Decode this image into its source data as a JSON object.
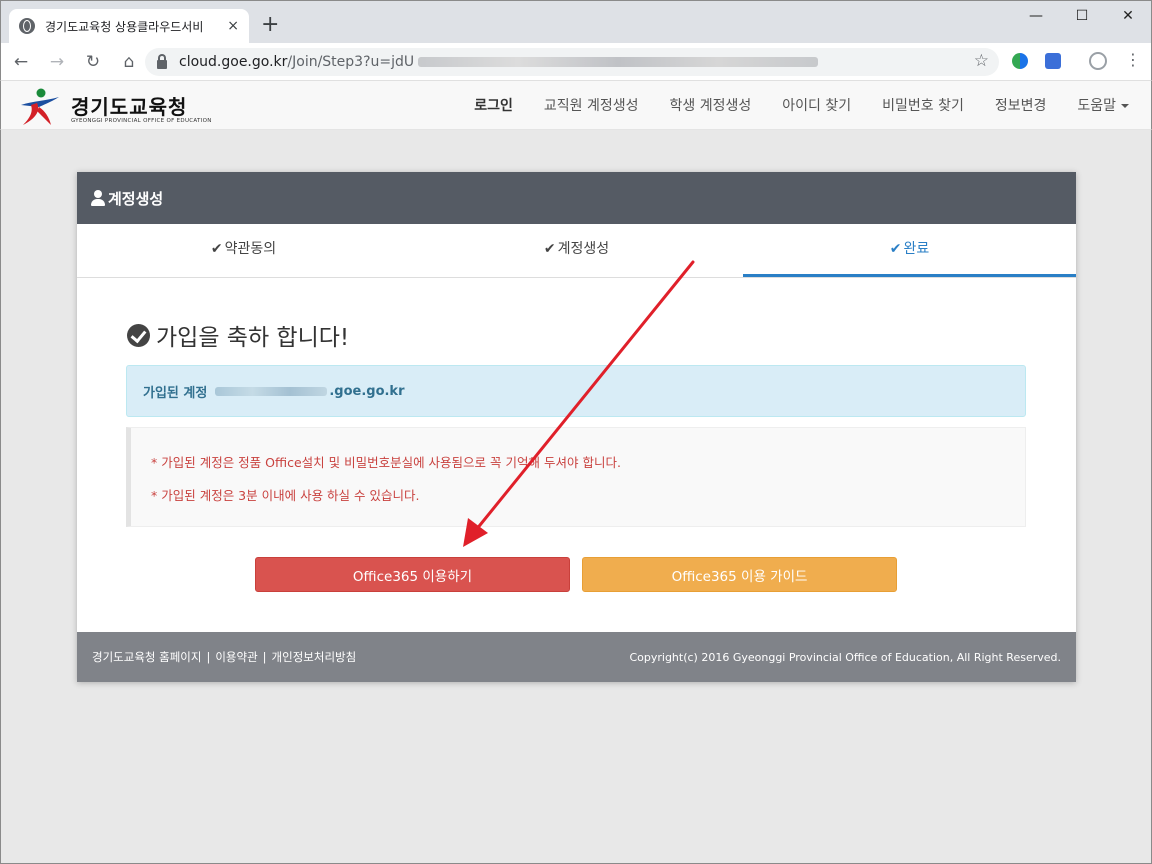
{
  "browser": {
    "tab_title": "경기도교육청 상용클라우드서비",
    "tab_close": "×",
    "new_tab": "+",
    "url_host": "cloud.goe.go.kr",
    "url_path": "/Join/Step3?u=jdU",
    "window_min": "—",
    "window_max": "☐",
    "window_close": "✕"
  },
  "site": {
    "logo_text": "경기도교육청",
    "logo_sub": "GYEONGGI PROVINCIAL OFFICE OF EDUCATION",
    "menu": [
      "로그인",
      "교직원 계정생성",
      "학생 계정생성",
      "아이디 찾기",
      "비밀번호 찾기",
      "정보변경",
      "도움말"
    ]
  },
  "panel": {
    "title": "계정생성",
    "steps": [
      "약관동의",
      "계정생성",
      "완료"
    ],
    "active_step": 2,
    "congrats": "가입을 축하 합니다!",
    "info_label": "가입된 계정",
    "info_domain": ".goe.go.kr",
    "notices": [
      "* 가입된 계정은 정품 Office설치 및 비밀번호분실에 사용됨으로 꼭 기억해 두셔야 합니다.",
      "* 가입된 계정은 3분 이내에 사용 하실 수 있습니다."
    ],
    "btn_use": "Office365 이용하기",
    "btn_guide": "Office365 이용 가이드"
  },
  "footer": {
    "links": [
      "경기도교육청 홈페이지",
      "이용약관",
      "개인정보처리방침"
    ],
    "copyright": "Copyright(c) 2016 Gyeonggi Provincial Office of Education, All Right Reserved."
  },
  "colors": {
    "panel_header": "#555b64",
    "active_step": "#2a7fc6",
    "btn_use": "#d9534f",
    "btn_guide": "#f0ad4e",
    "notice_text": "#c9423f",
    "annotation_arrow": "#e0202a"
  }
}
